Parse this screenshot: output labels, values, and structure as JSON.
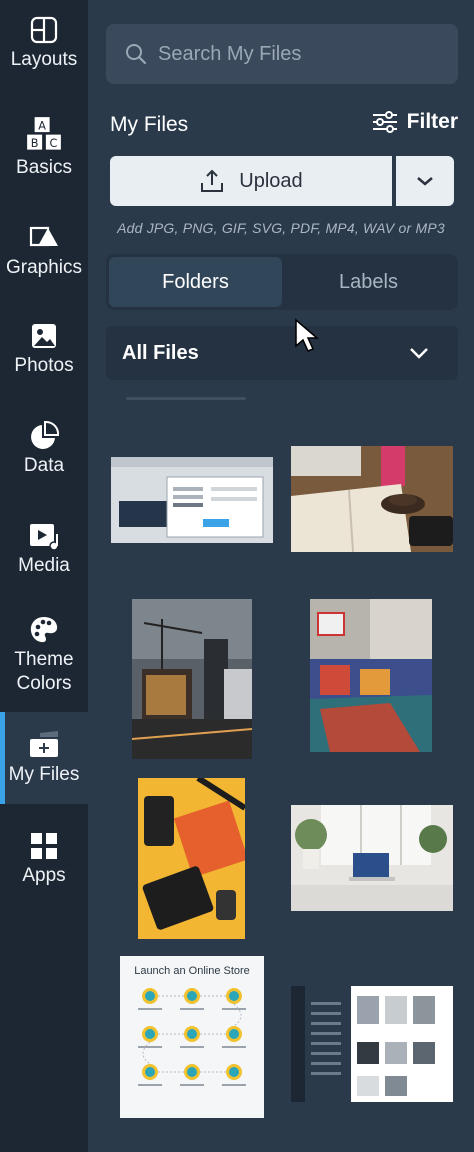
{
  "rail": {
    "items": [
      {
        "label": "Layouts"
      },
      {
        "label": "Basics"
      },
      {
        "label": "Graphics"
      },
      {
        "label": "Photos"
      },
      {
        "label": "Data"
      },
      {
        "label": "Media"
      },
      {
        "label": "Theme Colors"
      },
      {
        "label": "My Files",
        "active": true
      },
      {
        "label": "Apps"
      }
    ]
  },
  "panel": {
    "search_placeholder": "Search My Files",
    "title": "My Files",
    "filter_label": "Filter",
    "upload_label": "Upload",
    "hint": "Add JPG, PNG, GIF, SVG, PDF, MP4, WAV or MP3",
    "tabs": [
      {
        "label": "Folders",
        "active": true
      },
      {
        "label": "Labels",
        "active": false
      }
    ],
    "folder_select": "All Files",
    "infographic_title": "Launch an Online Store"
  },
  "colors": {
    "rail_bg": "#1d2733",
    "panel_bg": "#2b3a4b",
    "accent": "#3aa3e8"
  }
}
